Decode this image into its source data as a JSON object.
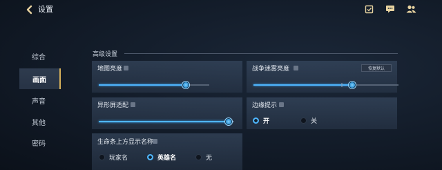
{
  "header": {
    "title": "设置",
    "icons": [
      "back-arrow-icon",
      "task-icon",
      "chat-icon",
      "friends-icon"
    ]
  },
  "sidebar": {
    "items": [
      {
        "label": "综合",
        "active": false
      },
      {
        "label": "画面",
        "active": true
      },
      {
        "label": "声音",
        "active": false
      },
      {
        "label": "其他",
        "active": false
      },
      {
        "label": "密码",
        "active": false
      }
    ]
  },
  "section": {
    "title": "高级设置"
  },
  "settings": {
    "map_brightness": {
      "label": "地图亮度",
      "value": 0.79
    },
    "fog_brightness": {
      "label": "战争迷雾亮度",
      "reset_label": "恢复默认",
      "value": 0.68,
      "default_mark": 0.61
    },
    "notch_adapt": {
      "label": "异形屏适配",
      "value": 0.96
    },
    "edge_hint": {
      "label": "边缘提示",
      "options": [
        "开",
        "关"
      ],
      "selected": "开"
    },
    "name_display": {
      "label": "生命条上方显示名称",
      "options": [
        "玩家名",
        "英雄名",
        "无"
      ],
      "selected": "英雄名"
    }
  },
  "colors": {
    "accent": "#4fb6ff",
    "active_tab_edge": "#d8b25a"
  }
}
